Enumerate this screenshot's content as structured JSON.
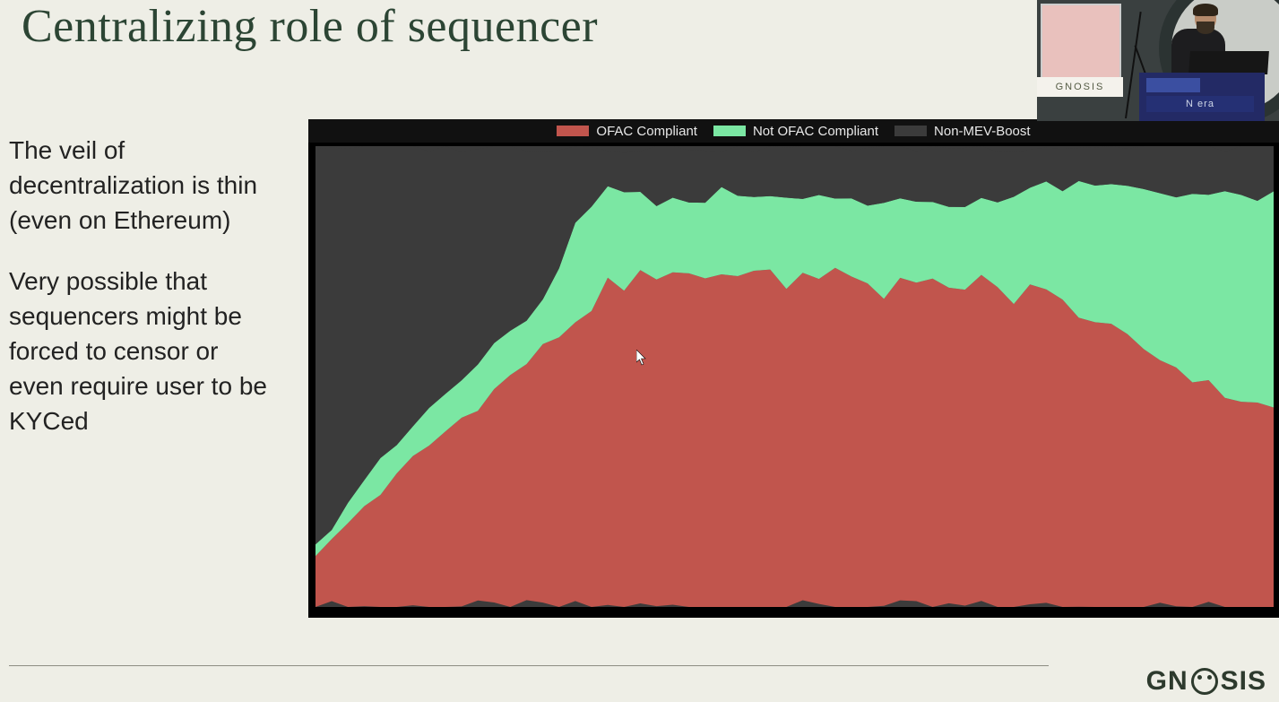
{
  "slide": {
    "title": "Centralizing role of sequencer",
    "paragraph1": "The veil of decentralization is thin (even on Ethereum)",
    "paragraph2": "Very possible that sequencers might be forced to censor or even require user to be KYCed"
  },
  "brand": {
    "name": "GNOSIS",
    "screen_bar_text": "GNOSIS",
    "podium_text": "N era"
  },
  "chart_data": {
    "type": "area",
    "title": "",
    "xlabel": "",
    "ylabel": "",
    "ylim": [
      0,
      100
    ],
    "stack_order": [
      "OFAC Compliant",
      "Not OFAC Compliant",
      "Non-MEV-Boost"
    ],
    "colors": {
      "OFAC Compliant": "#c1554d",
      "Not OFAC Compliant": "#7be7a3",
      "Non-MEV-Boost": "#3b3b3b"
    },
    "legend": [
      "OFAC Compliant",
      "Not OFAC Compliant",
      "Non-MEV-Boost"
    ],
    "x": [
      0,
      1,
      2,
      3,
      4,
      5,
      6,
      7,
      8,
      9,
      10,
      11,
      12,
      13,
      14,
      15,
      16,
      17,
      18,
      19,
      20,
      21,
      22,
      23,
      24,
      25,
      26,
      27,
      28,
      29,
      30,
      31,
      32,
      33,
      34,
      35,
      36,
      37,
      38,
      39,
      40,
      41,
      42,
      43,
      44,
      45,
      46,
      47,
      48,
      49,
      50,
      51,
      52,
      53,
      54,
      55,
      56,
      57,
      58,
      59
    ],
    "series": [
      {
        "name": "OFAC Compliant",
        "values": [
          12,
          14,
          18,
          22,
          25,
          28,
          32,
          35,
          38,
          41,
          44,
          47,
          50,
          53,
          56,
          59,
          62,
          65,
          70,
          68,
          72,
          70,
          74,
          72,
          70,
          73,
          71,
          74,
          72,
          70,
          73,
          71,
          74,
          72,
          70,
          68,
          71,
          69,
          72,
          70,
          68,
          71,
          69,
          67,
          70,
          68,
          66,
          64,
          62,
          60,
          58,
          56,
          54,
          52,
          50,
          48,
          46,
          45,
          44,
          43
        ]
      },
      {
        "name": "Not OFAC Compliant",
        "values": [
          3,
          4,
          5,
          6,
          6,
          7,
          7,
          8,
          8,
          8,
          9,
          9,
          9,
          10,
          10,
          14,
          20,
          22,
          20,
          22,
          18,
          17,
          16,
          17,
          18,
          17,
          18,
          16,
          17,
          18,
          17,
          18,
          16,
          17,
          18,
          19,
          17,
          18,
          16,
          17,
          19,
          18,
          20,
          22,
          21,
          23,
          25,
          27,
          29,
          31,
          33,
          35,
          36,
          38,
          40,
          41,
          43,
          44,
          45,
          46
        ]
      },
      {
        "name": "Non-MEV-Boost",
        "values": [
          85,
          82,
          77,
          72,
          69,
          65,
          61,
          57,
          54,
          51,
          47,
          44,
          41,
          37,
          34,
          27,
          18,
          13,
          10,
          10,
          10,
          13,
          10,
          11,
          12,
          10,
          11,
          10,
          11,
          12,
          10,
          11,
          10,
          11,
          12,
          13,
          12,
          13,
          12,
          13,
          13,
          11,
          11,
          11,
          9,
          9,
          9,
          9,
          9,
          9,
          9,
          9,
          10,
          10,
          10,
          11,
          11,
          11,
          11,
          11
        ]
      }
    ]
  }
}
